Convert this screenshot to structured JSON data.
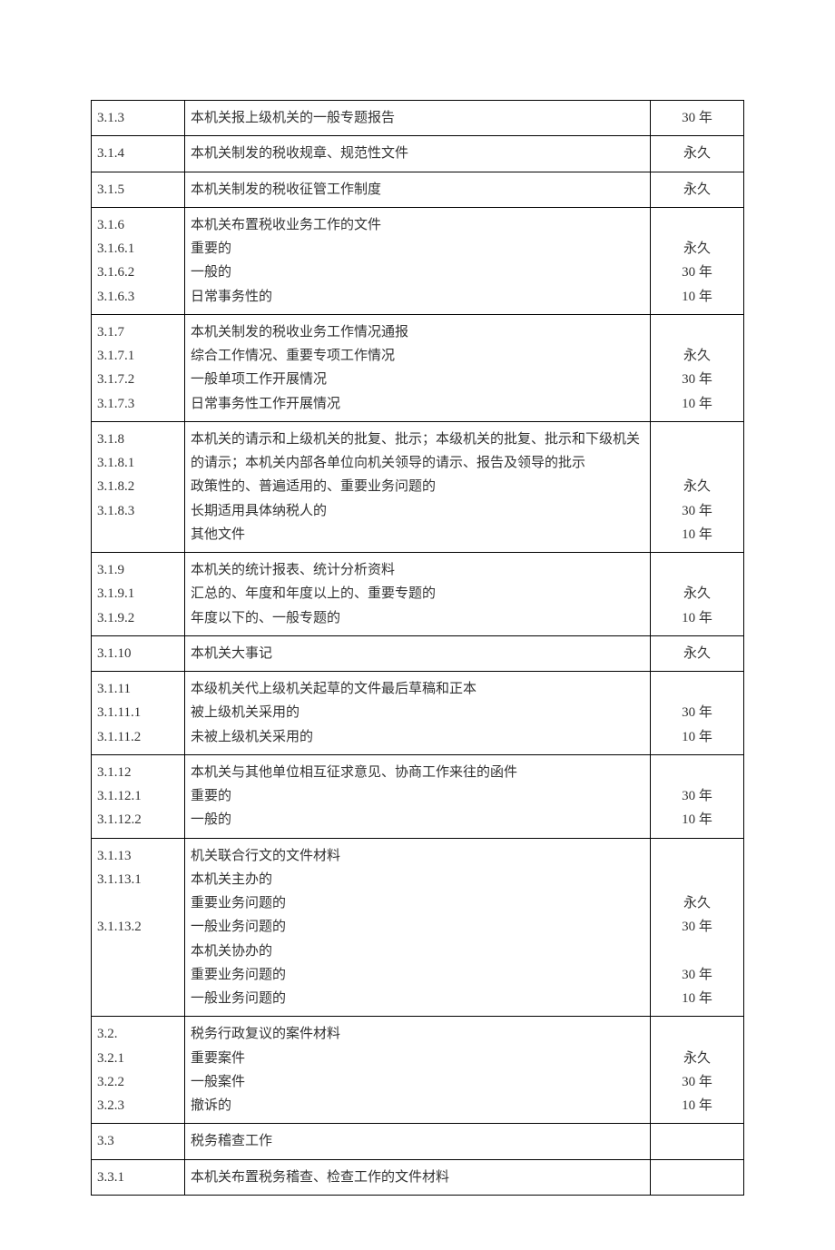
{
  "rows": [
    {
      "codes": [
        "3.1.3"
      ],
      "descs": [
        "本机关报上级机关的一般专题报告"
      ],
      "rets": [
        "30 年"
      ]
    },
    {
      "codes": [
        "3.1.4"
      ],
      "descs": [
        "本机关制发的税收规章、规范性文件"
      ],
      "rets": [
        "永久"
      ]
    },
    {
      "codes": [
        "3.1.5"
      ],
      "descs": [
        "本机关制发的税收征管工作制度"
      ],
      "rets": [
        "永久"
      ]
    },
    {
      "codes": [
        "3.1.6",
        "3.1.6.1",
        "3.1.6.2",
        "3.1.6.3"
      ],
      "descs": [
        "本机关布置税收业务工作的文件",
        "重要的",
        "一般的",
        "日常事务性的"
      ],
      "rets": [
        "",
        "永久",
        "30 年",
        "10 年"
      ]
    },
    {
      "codes": [
        "3.1.7",
        "3.1.7.1",
        "3.1.7.2",
        "3.1.7.3"
      ],
      "descs": [
        "本机关制发的税收业务工作情况通报",
        "综合工作情况、重要专项工作情况",
        "一般单项工作开展情况",
        "日常事务性工作开展情况"
      ],
      "rets": [
        "",
        "永久",
        "30 年",
        "10 年"
      ]
    },
    {
      "codes": [
        "3.1.8",
        "3.1.8.1",
        "3.1.8.2",
        "3.1.8.3"
      ],
      "descs": [
        "本机关的请示和上级机关的批复、批示；本级机关的批复、批示和下级机关的请示；本机关内部各单位向机关领导的请示、报告及领导的批示",
        "政策性的、普遍适用的、重要业务问题的",
        "长期适用具体纳税人的",
        "其他文件"
      ],
      "rets": [
        "",
        "",
        "永久",
        "30 年",
        "10 年"
      ]
    },
    {
      "codes": [
        "3.1.9",
        "3.1.9.1",
        "3.1.9.2"
      ],
      "descs": [
        "本机关的统计报表、统计分析资料",
        "汇总的、年度和年度以上的、重要专题的",
        "年度以下的、一般专题的"
      ],
      "rets": [
        "",
        "永久",
        "10 年"
      ]
    },
    {
      "codes": [
        "3.1.10"
      ],
      "descs": [
        "本机关大事记"
      ],
      "rets": [
        "永久"
      ]
    },
    {
      "codes": [
        "3.1.11",
        "3.1.11.1",
        "3.1.11.2"
      ],
      "descs": [
        "本级机关代上级机关起草的文件最后草稿和正本",
        "被上级机关采用的",
        "未被上级机关采用的"
      ],
      "rets": [
        "",
        "30 年",
        "10 年"
      ]
    },
    {
      "codes": [
        "3.1.12",
        "3.1.12.1",
        "3.1.12.2"
      ],
      "descs": [
        "本机关与其他单位相互征求意见、协商工作来往的函件",
        "重要的",
        "一般的"
      ],
      "rets": [
        "",
        "30 年",
        "10 年"
      ]
    },
    {
      "codes": [
        "3.1.13",
        "3.1.13.1",
        "",
        "3.1.13.2"
      ],
      "descs": [
        "机关联合行文的文件材料",
        "本机关主办的",
        "重要业务问题的",
        "一般业务问题的",
        "本机关协办的",
        "重要业务问题的",
        "一般业务问题的"
      ],
      "rets": [
        "",
        "",
        "永久",
        "30 年",
        "",
        "30 年",
        "10 年"
      ]
    },
    {
      "codes": [
        "3.2.",
        "3.2.1",
        "3.2.2",
        "3.2.3"
      ],
      "descs": [
        "税务行政复议的案件材料",
        "重要案件",
        "一般案件",
        "撤诉的"
      ],
      "rets": [
        "",
        "永久",
        "30 年",
        "10 年"
      ]
    },
    {
      "codes": [
        "3.3"
      ],
      "descs": [
        "税务稽查工作"
      ],
      "rets": [
        ""
      ]
    },
    {
      "codes": [
        "3.3.1"
      ],
      "descs": [
        "本机关布置税务稽查、检查工作的文件材料"
      ],
      "rets": [
        ""
      ]
    }
  ]
}
